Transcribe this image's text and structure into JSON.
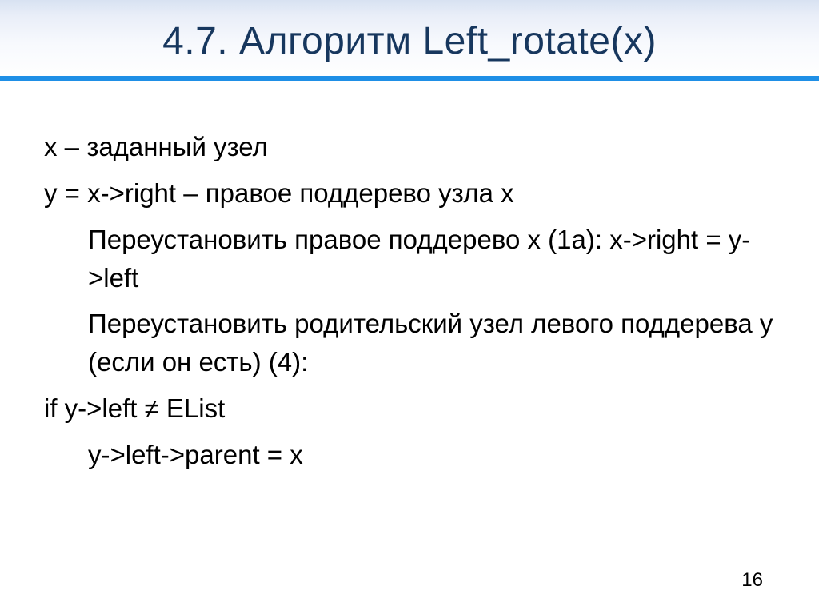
{
  "title": "4.7. Алгоритм Left_rotate(x)",
  "body": {
    "l1": "x – заданный узел",
    "l2": "y = x->right – правое поддерево узла x",
    "l3": "Переустановить правое поддерево x (1a): x->right = y->left",
    "l4": "Переустановить родительский узел левого поддерева y (если он есть) (4):",
    "l5": "if y->left ≠ EList",
    "l6": "y->left->parent = x"
  },
  "page_number": "16"
}
